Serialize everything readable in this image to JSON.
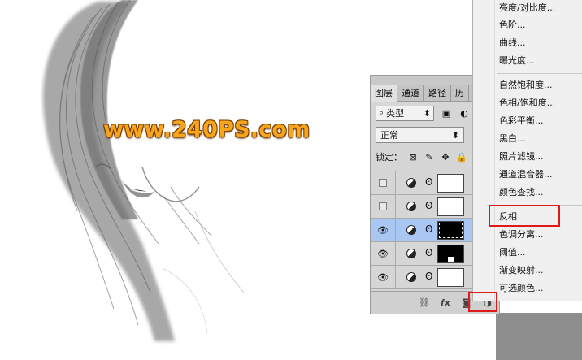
{
  "watermark": "www.240PS.com",
  "panel": {
    "tabs": [
      "图层",
      "通道",
      "路径",
      "历"
    ],
    "filter_label": "类型",
    "blend_mode": "正常",
    "lock_label": "锁定："
  },
  "layers": [
    {
      "visible": false,
      "mask": "white"
    },
    {
      "visible": false,
      "mask": "white"
    },
    {
      "visible": true,
      "mask": "black",
      "selected": true
    },
    {
      "visible": true,
      "mask": "black-spot"
    },
    {
      "visible": true,
      "mask": "white"
    }
  ],
  "footer": {
    "fx_label": "fx"
  },
  "menu": {
    "items": [
      "亮度/对比度...",
      "色阶...",
      "曲线...",
      "曝光度...",
      "自然饱和度...",
      "色相/饱和度...",
      "色彩平衡...",
      "黑白...",
      "照片滤镜...",
      "通道混合器...",
      "颜色查找...",
      "反相",
      "色调分离...",
      "阈值...",
      "渐变映射...",
      "可选颜色..."
    ],
    "highlighted": "反相"
  },
  "colors": {
    "highlight_box": "#e01a1a",
    "watermark": "#f6a51c",
    "selected_layer": "#a9c7f2"
  }
}
